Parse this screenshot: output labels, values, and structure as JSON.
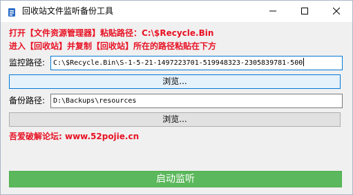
{
  "window": {
    "title": "回收站文件监听备份工具"
  },
  "instructions": {
    "line1": "打开【文件资源管理器】粘贴路径：C:\\$Recycle.Bin",
    "line2": "进入【回收站】并复制【回收站】所在的路径粘贴在下方"
  },
  "monitor": {
    "label": "监控路径:",
    "value": "C:\\$Recycle.Bin\\S-1-5-21-1497223701-519948323-2305839781-500",
    "browse_label": "浏览..."
  },
  "backup": {
    "label": "备份路径:",
    "value": "D:\\Backups\\resources",
    "browse_label": "浏览..."
  },
  "forum": {
    "text": "吾爱破解论坛:  www.52pojie.cn"
  },
  "actions": {
    "start_label": "启动监听"
  },
  "colors": {
    "instruction_red": "#e81123",
    "start_green": "#5cb85c",
    "focus_blue": "#0078d7"
  },
  "icons": {
    "app": "recycle-bin-icon",
    "minimize": "minimize-icon",
    "maximize": "maximize-icon",
    "close": "close-icon"
  }
}
